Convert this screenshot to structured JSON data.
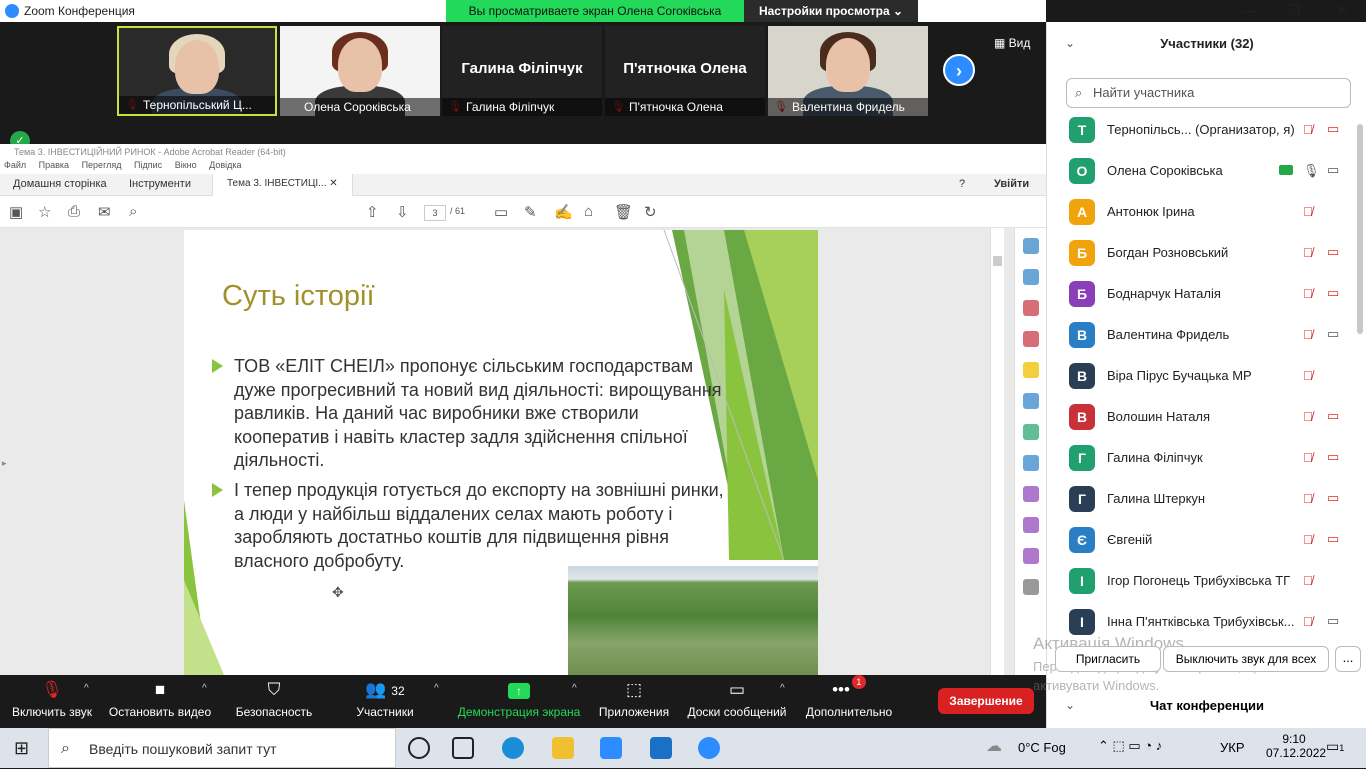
{
  "zoom": {
    "title": "Zoom Конференция",
    "share_banner": "Вы просматриваете экран Олена Соroківська",
    "view_options": "Настройки просмотра",
    "view_label": "Вид",
    "participants_tiles": [
      {
        "name": "Тернопільський Ц...",
        "muted": true,
        "pinned": true,
        "video": true
      },
      {
        "name": "Олена Сороківська",
        "muted": false,
        "pinned": true,
        "video": true
      },
      {
        "name": "Галина Філіпчук",
        "muted": true,
        "pinned": false,
        "video": false,
        "display": "Галина Філіпчук"
      },
      {
        "name": "П'ятночка Олена",
        "muted": true,
        "pinned": false,
        "video": false,
        "display": "П'ятночка Олена"
      },
      {
        "name": "Валентина Фридель",
        "muted": true,
        "pinned": false,
        "video": true
      }
    ],
    "toolbar": [
      {
        "label": "Включить звук",
        "icon": "mic-muted-icon"
      },
      {
        "label": "Остановить видео",
        "icon": "video-icon"
      },
      {
        "label": "Безопасность",
        "icon": "shield-icon"
      },
      {
        "label": "Участники",
        "icon": "participants-icon",
        "count": "32"
      },
      {
        "label": "Демонстрация экрана",
        "icon": "share-screen-icon"
      },
      {
        "label": "Приложения",
        "icon": "apps-icon"
      },
      {
        "label": "Доски сообщений",
        "icon": "whiteboard-icon"
      },
      {
        "label": "Дополнительно",
        "icon": "more-icon",
        "badge": "1"
      }
    ],
    "end_button": "Завершение"
  },
  "acrobat": {
    "title": "Тема 3. ІНВЕСТИЦІЙНИЙ РИНОК - Adobe Acrobat Reader (64-bit)",
    "menu": [
      "Файл",
      "Правка",
      "Перегляд",
      "Підпис",
      "Вікно",
      "Довідка"
    ],
    "tabs": {
      "home": "Домашня сторінка",
      "tools": "Інструменти",
      "doc": "Тема 3. ІНВЕСТИЦІ..."
    },
    "signin": "Увійти",
    "page_current": "3",
    "page_total": "/ 61",
    "slide": {
      "title": "Суть історії",
      "bullets": [
        "ТОВ «ЕЛІТ СНЕІЛ» пропонує сільським господарствам дуже прогресивний та новий вид діяльності: вирощування равликів. На даний час виробники вже створили кооператив і навіть кластер задля здійснення спільної діяльності.",
        "І тепер продукція готується до експорту на зовнішні ринки, а люди у найбільш віддалених селах мають роботу і заробляють достатньо коштів для підвищення рівня власного добробуту."
      ]
    }
  },
  "panel": {
    "header": "Участники (32)",
    "search_placeholder": "Найти участника",
    "participants": [
      {
        "initial": "Т",
        "name": "Тернопільсь...  (Организатор, я)",
        "color": "#1fa06e",
        "mic": "muted",
        "cam": "off"
      },
      {
        "initial": "О",
        "name": "Олена Сороківська",
        "color": "#1fa06e",
        "mic": "on",
        "cam": "on",
        "sharing": true
      },
      {
        "initial": "А",
        "name": "Антонюк Ірина",
        "color": "#f0a30a",
        "mic": "muted",
        "cam": "none"
      },
      {
        "initial": "Б",
        "name": "Богдан Розновський",
        "color": "#f0a30a",
        "mic": "muted",
        "cam": "off"
      },
      {
        "initial": "Б",
        "name": "Боднарчук Наталія",
        "color": "#8a3fb8",
        "mic": "muted",
        "cam": "off"
      },
      {
        "initial": "В",
        "name": "Валентина Фридель",
        "color": "#2a7fc4",
        "mic": "muted",
        "cam": "on"
      },
      {
        "initial": "В",
        "name": "Віра Пірус Бучацька МР",
        "color": "#2a3e55",
        "mic": "muted",
        "cam": "none"
      },
      {
        "initial": "В",
        "name": "Волошин Наталя",
        "color": "#c8303a",
        "mic": "muted",
        "cam": "off"
      },
      {
        "initial": "Г",
        "name": "Галина Філіпчук",
        "color": "#1fa06e",
        "mic": "muted",
        "cam": "off"
      },
      {
        "initial": "Г",
        "name": "Галина Штеркун",
        "color": "#2a3e55",
        "mic": "muted",
        "cam": "off"
      },
      {
        "initial": "Є",
        "name": "Євгеній",
        "color": "#2a7fc4",
        "mic": "muted",
        "cam": "off"
      },
      {
        "initial": "І",
        "name": "Ігор Погонець Трибухівська ТГ",
        "color": "#1fa06e",
        "mic": "muted",
        "cam": "none"
      },
      {
        "initial": "І",
        "name": "Інна П'янтківська Трибухівськ...",
        "color": "#2a3e55",
        "mic": "muted",
        "cam": "on"
      }
    ],
    "invite": "Пригласить",
    "mute_all": "Выключить звук для всех",
    "more": "...",
    "chat_header": "Чат конференции",
    "activation_title": "Активація Windows",
    "activation_text": "Перейдіть до розділу \"Настройки\", щоб активувати Windows."
  },
  "taskbar": {
    "search_placeholder": "Введіть пошуковий запит тут",
    "weather": "0°C  Fog",
    "language": "УКР",
    "time": "9:10",
    "date": "07.12.2022",
    "notifications": "1"
  }
}
